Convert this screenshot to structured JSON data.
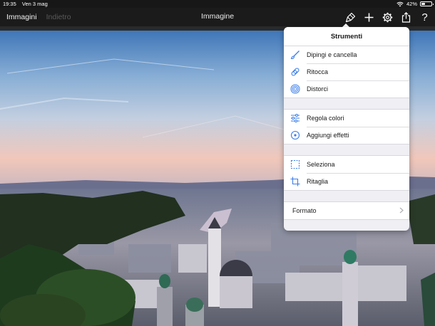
{
  "status_bar": {
    "time": "19:35",
    "date": "Ven 3 mag",
    "battery": "42%",
    "battery_level": 0.42
  },
  "nav": {
    "images_label": "Immagini",
    "back_label": "Indietro",
    "title": "Immagine",
    "icons": [
      "brush-icon",
      "plus-icon",
      "gear-icon",
      "share-icon",
      "help-icon"
    ],
    "help_glyph": "?"
  },
  "popover": {
    "title": "Strumenti",
    "groups": [
      [
        {
          "label": "Dipingi e cancella",
          "icon": "paintbrush-icon"
        },
        {
          "label": "Ritocca",
          "icon": "bandage-icon"
        },
        {
          "label": "Distorci",
          "icon": "spiral-icon"
        }
      ],
      [
        {
          "label": "Regola colori",
          "icon": "sliders-icon"
        },
        {
          "label": "Aggiungi effetti",
          "icon": "effects-icon"
        }
      ],
      [
        {
          "label": "Seleziona",
          "icon": "selection-icon"
        },
        {
          "label": "Ritaglia",
          "icon": "crop-icon"
        }
      ]
    ],
    "format_label": "Formato"
  },
  "colors": {
    "accent": "#3b7ee8",
    "popover_bg": "#efeff4",
    "bar_bg": "#1b1b1b"
  }
}
